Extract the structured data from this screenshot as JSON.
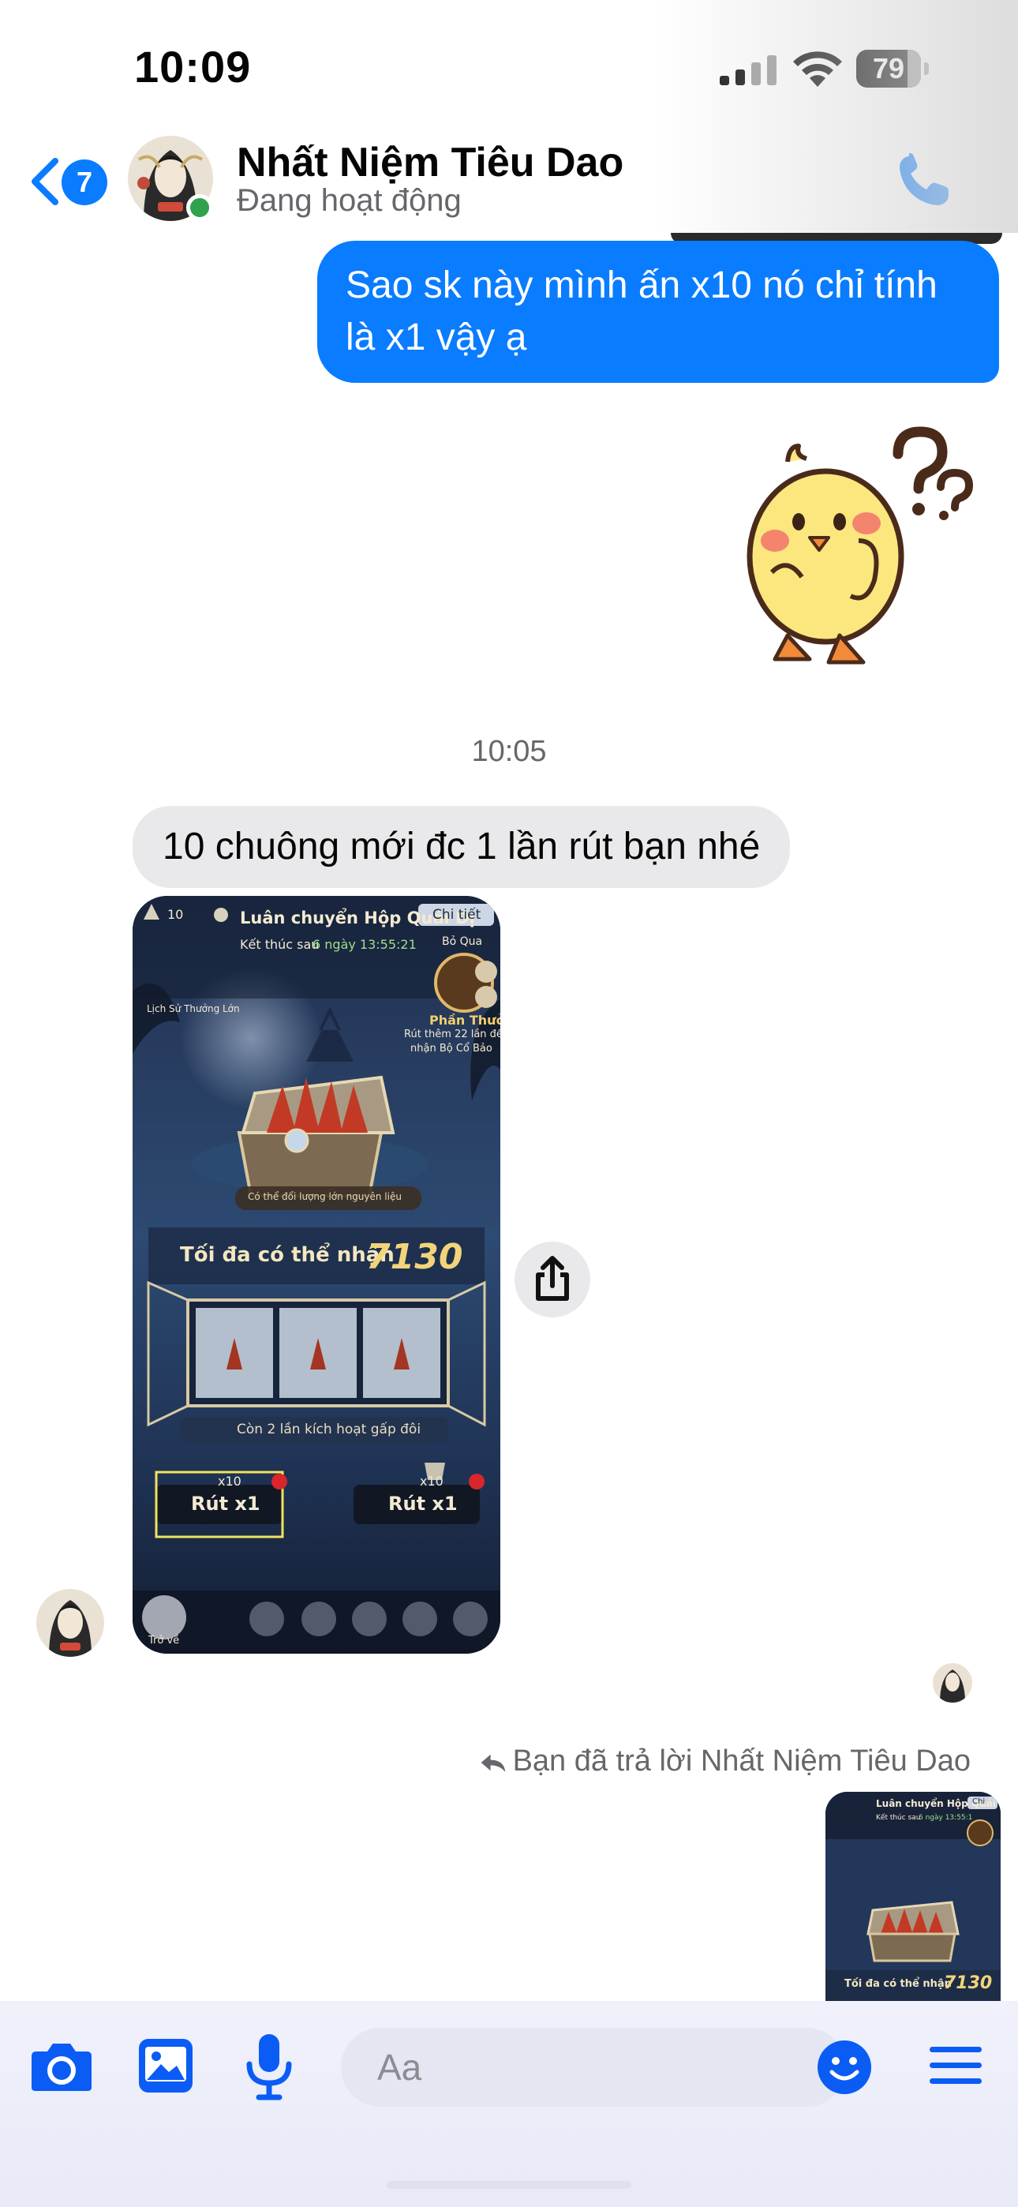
{
  "status_bar": {
    "time": "10:09",
    "battery": "79",
    "battery_level": 0.79,
    "signal_icon": "cellular-signal-icon",
    "wifi_icon": "wifi-icon"
  },
  "header": {
    "unread_count": "7",
    "contact_name": "Nhất Niệm Tiêu Dao",
    "contact_status": "Đang hoạt động",
    "back_icon": "chevron-left-icon",
    "call_icon": "phone-icon",
    "accent_color": "#0a7cff",
    "online_color": "#31a24c"
  },
  "messages": {
    "outgoing_1": "Sao sk này mình ấn x10 nó chỉ tính là x1 vậy ạ",
    "sticker_icon": "confused-chick-sticker",
    "timestamp": "10:05",
    "incoming_1": "10 chuông mới đc 1 lần rút bạn nhé",
    "reply_note": "Bạn đã trả lời Nhất Niệm Tiêu Dao",
    "reply_icon": "reply-arrow-icon",
    "share_icon": "share-icon"
  },
  "game_screenshot": {
    "bell_count": "10",
    "event_title": "Luân chuyển Hộp Quái Dị",
    "detail_button": "Chi tiết",
    "ends_label": "Kết thúc sau",
    "ends_time": "6 ngày 13:55:21",
    "gift_label": "Bỏ Qua",
    "reward_title": "Phần Thưởng",
    "reward_desc_1": "Rút thêm 22 lần để",
    "reward_desc_2": "nhận Bộ Cổ Bảo",
    "history_label": "Lịch Sử Thưởng Lớn",
    "exchange_banner": "Có thể đổi lượng lớn nguyên liệu",
    "max_label": "Tối đa có thể nhận",
    "max_value": "7130",
    "double_label": "Còn 2 lần kích hoạt gấp đôi",
    "cost_left": "x10",
    "cost_right": "x10",
    "draw_left": "Rút x1",
    "draw_right": "Rút x1",
    "back_label": "Trở về"
  },
  "reply_thumb": {
    "event_title": "Luân chuyển Hộp Quái Dị",
    "detail_button": "Chi",
    "ends_label": "Kết thúc sau",
    "ends_time": "6 ngày 13:55:1",
    "max_label": "Tối đa có thể nhận",
    "max_value": "7130"
  },
  "composer": {
    "placeholder": "Aa",
    "camera_icon": "camera-icon",
    "gallery_icon": "image-icon",
    "mic_icon": "microphone-icon",
    "emoji_icon": "smiley-icon",
    "menu_icon": "menu-icon"
  }
}
